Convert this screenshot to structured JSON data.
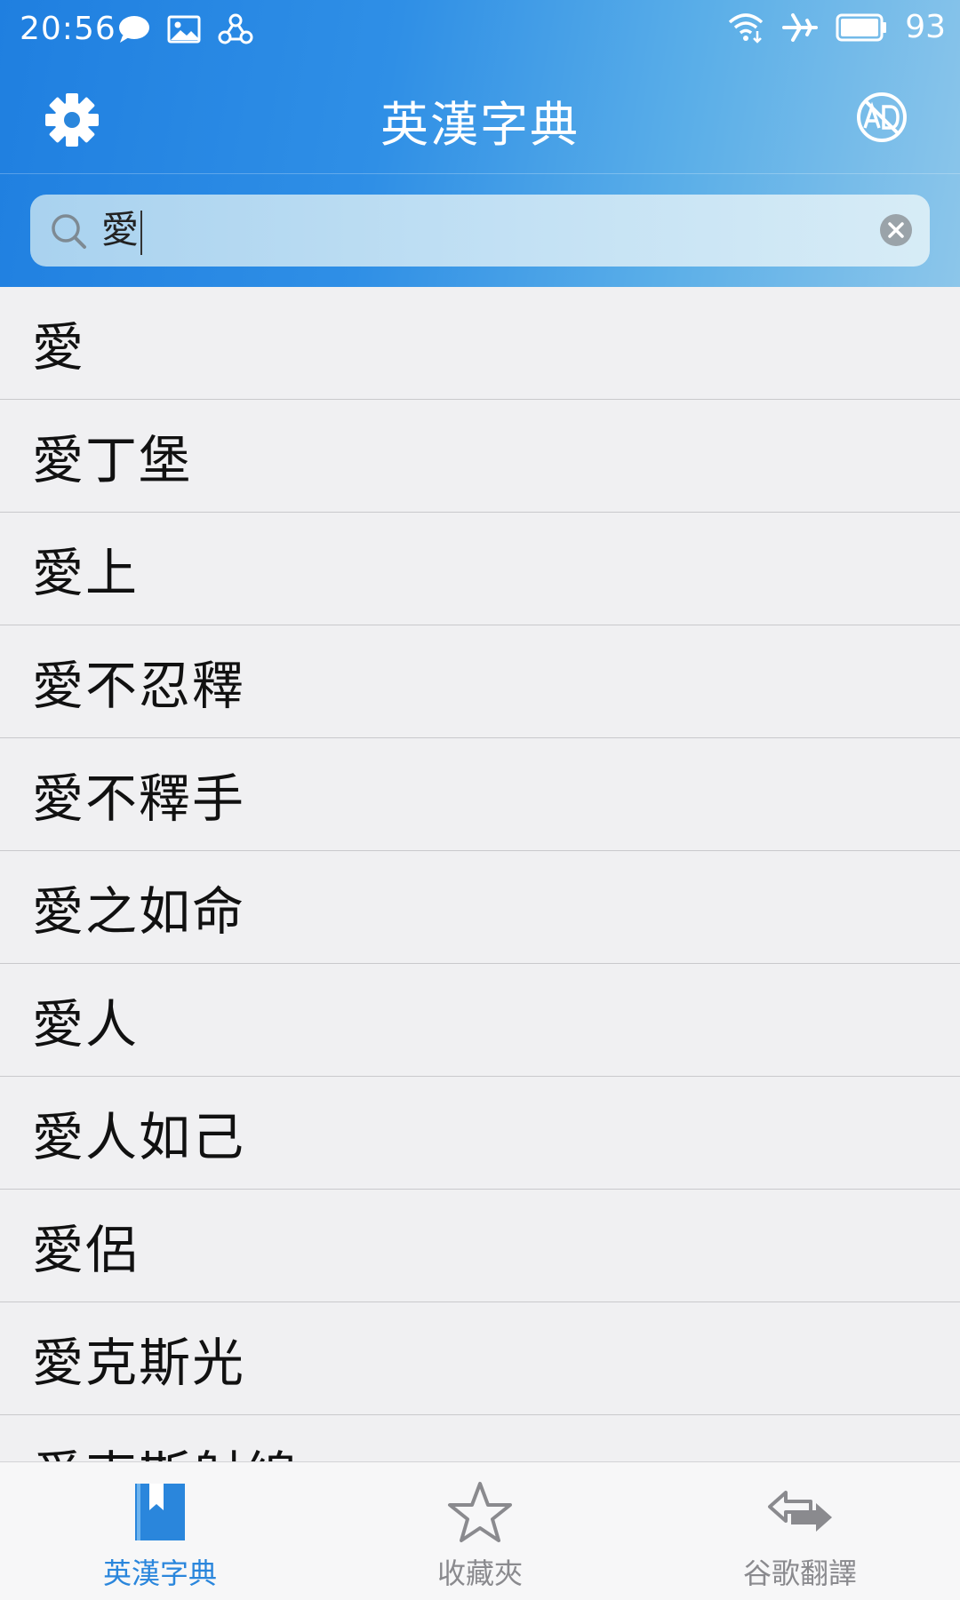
{
  "status_bar": {
    "time": "20:56",
    "battery": "93",
    "left_icons": [
      "chat-bubble-icon",
      "image-icon",
      "link-icon"
    ],
    "right_icons": [
      "wifi-icon",
      "airplane-icon",
      "battery-icon"
    ]
  },
  "header": {
    "title": "英漢字典",
    "left_icon": "gear-icon",
    "right_icon": "no-ad-icon"
  },
  "search": {
    "value": "愛",
    "icon": "search-icon",
    "clear_icon": "clear-icon"
  },
  "results": [
    "愛",
    "愛丁堡",
    "愛上",
    "愛不忍釋",
    "愛不釋手",
    "愛之如命",
    "愛人",
    "愛人如己",
    "愛侶",
    "愛克斯光",
    "愛克斯射線"
  ],
  "tabs": [
    {
      "label": "英漢字典",
      "icon": "dictionary-book-icon",
      "active": true
    },
    {
      "label": "收藏夾",
      "icon": "star-icon",
      "active": false
    },
    {
      "label": "谷歌翻譯",
      "icon": "swap-arrows-icon",
      "active": false
    }
  ],
  "colors": {
    "accent": "#2a86dc",
    "header_start": "#1f7fe0",
    "header_end": "#8cc6ea",
    "tab_inactive": "#8a8a8e"
  }
}
